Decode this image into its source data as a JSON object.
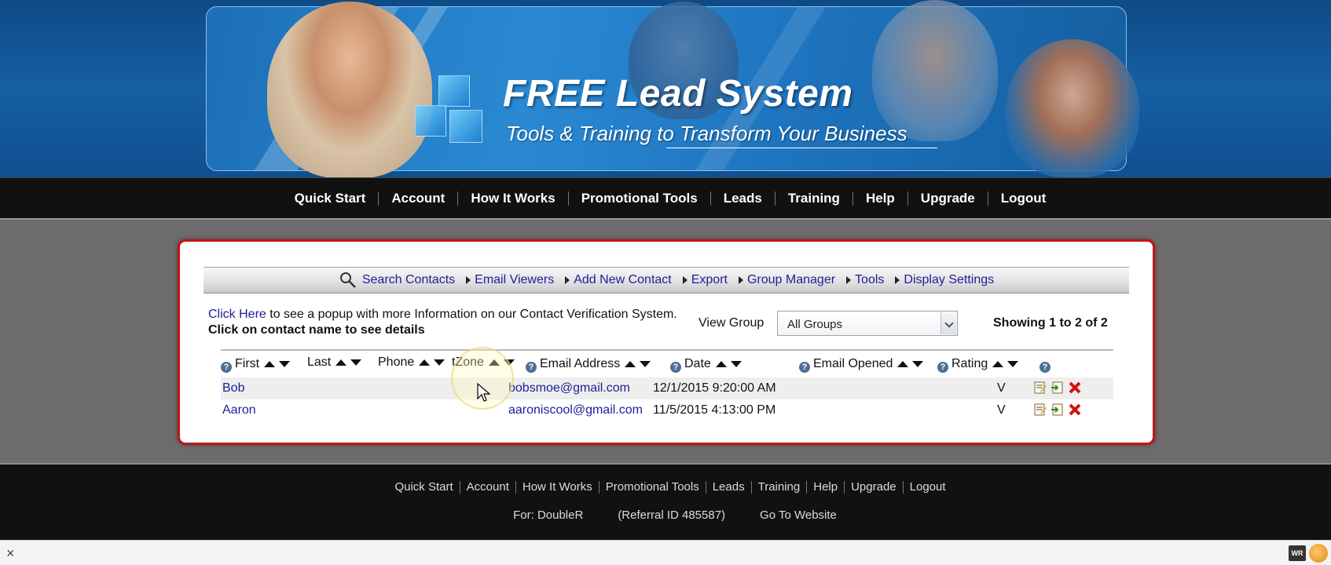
{
  "banner": {
    "title": "FREE Lead System",
    "tagline": "Tools & Training to Transform Your Business"
  },
  "top_nav": [
    "Quick Start",
    "Account",
    "How It Works",
    "Promotional Tools",
    "Leads",
    "Training",
    "Help",
    "Upgrade",
    "Logout"
  ],
  "toolbar": {
    "search_label": "Search Contacts",
    "items": [
      "Email Viewers",
      "Add New Contact",
      "Export",
      "Group Manager",
      "Tools",
      "Display Settings"
    ]
  },
  "info": {
    "click_here": "Click Here",
    "popup_text": " to see a popup with more Information on our Contact Verification System.",
    "details_text": "Click on contact name to see details"
  },
  "view_group": {
    "label": "View Group",
    "selected": "All Groups"
  },
  "showing": "Showing 1 to 2 of 2",
  "table": {
    "help_glyph": "?",
    "columns": {
      "first": "First",
      "last": "Last",
      "phone": "Phone",
      "zone": "tZone",
      "email": "Email Address",
      "date": "Date",
      "opened": "Email Opened",
      "rating": "Rating"
    },
    "rows": [
      {
        "first": "Bob",
        "email": "bobsmoe@gmail.com",
        "date": "12/1/2015 9:20:00 AM",
        "verified": "V"
      },
      {
        "first": "Aaron",
        "email": "aaroniscool@gmail.com",
        "date": "11/5/2015 4:13:00 PM",
        "verified": "V"
      }
    ]
  },
  "footer_nav": [
    "Quick Start",
    "Account",
    "How It Works",
    "Promotional Tools",
    "Leads",
    "Training",
    "Help",
    "Upgrade",
    "Logout"
  ],
  "footer_info": {
    "for": "For: DoubleR",
    "referral": "(Referral ID 485587)",
    "website": "Go To Website"
  },
  "status_bar": {
    "close_glyph": "×",
    "tool_label": "WR"
  },
  "colors": {
    "link": "#1f1e96",
    "box_border": "#c31414",
    "nav_bg": "#111111",
    "page_bg": "#6e6b6c"
  }
}
